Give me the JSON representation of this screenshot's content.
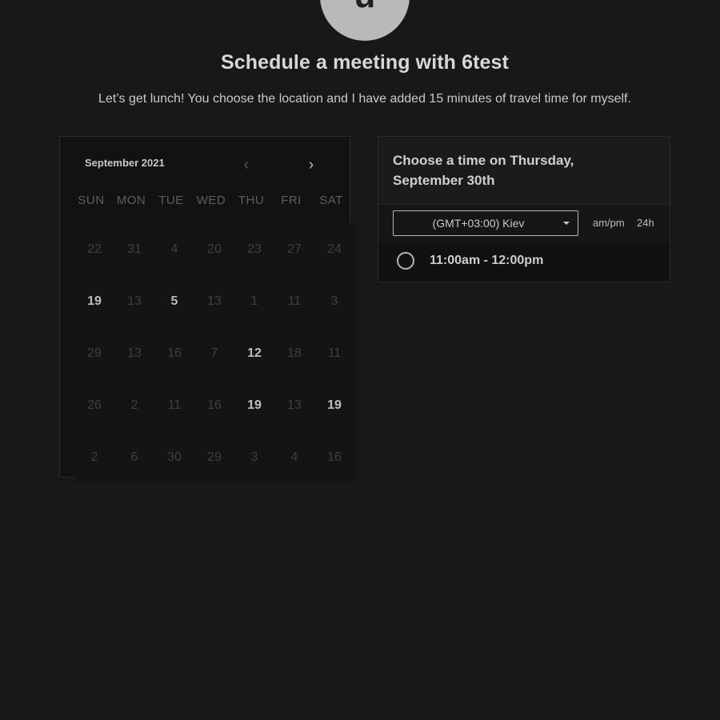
{
  "avatar": {
    "initial": "u"
  },
  "header": {
    "title": "Schedule a meeting with 6test",
    "subtitle": "Let’s get lunch! You choose the location and I have added 15 minutes of travel time for myself."
  },
  "calendar": {
    "month_label": "September 2021",
    "prev_icon": "chevron-left-icon",
    "next_icon": "chevron-right-icon",
    "weekdays": [
      "SUN",
      "MON",
      "TUE",
      "WED",
      "THU",
      "FRI",
      "SAT"
    ],
    "days": [
      {
        "label": "22",
        "available": false
      },
      {
        "label": "31",
        "available": false
      },
      {
        "label": "4",
        "available": false
      },
      {
        "label": "20",
        "available": false
      },
      {
        "label": "23",
        "available": false
      },
      {
        "label": "27",
        "available": false
      },
      {
        "label": "24",
        "available": false
      },
      {
        "label": "19",
        "available": true
      },
      {
        "label": "13",
        "available": false
      },
      {
        "label": "5",
        "available": true
      },
      {
        "label": "13",
        "available": false
      },
      {
        "label": "1",
        "available": false
      },
      {
        "label": "11",
        "available": false
      },
      {
        "label": "3",
        "available": false
      },
      {
        "label": "29",
        "available": false
      },
      {
        "label": "13",
        "available": false
      },
      {
        "label": "16",
        "available": false
      },
      {
        "label": "7",
        "available": false
      },
      {
        "label": "12",
        "available": true
      },
      {
        "label": "18",
        "available": false
      },
      {
        "label": "11",
        "available": false
      },
      {
        "label": "26",
        "available": false
      },
      {
        "label": "2",
        "available": false
      },
      {
        "label": "11",
        "available": false
      },
      {
        "label": "16",
        "available": false
      },
      {
        "label": "19",
        "available": true
      },
      {
        "label": "13",
        "available": false
      },
      {
        "label": "19",
        "available": true
      },
      {
        "label": "2",
        "available": false
      },
      {
        "label": "6",
        "available": false
      },
      {
        "label": "30",
        "available": false
      },
      {
        "label": "29",
        "available": false
      },
      {
        "label": "3",
        "available": false
      },
      {
        "label": "4",
        "available": false
      },
      {
        "label": "16",
        "available": false
      }
    ]
  },
  "time_panel": {
    "title": "Choose a time on Thursday, September 30th",
    "timezone": "(GMT+03:00) Kiev",
    "format_ampm": "am/pm",
    "format_24h": "24h",
    "slots": [
      {
        "label": "11:00am - 12:00pm"
      }
    ]
  }
}
